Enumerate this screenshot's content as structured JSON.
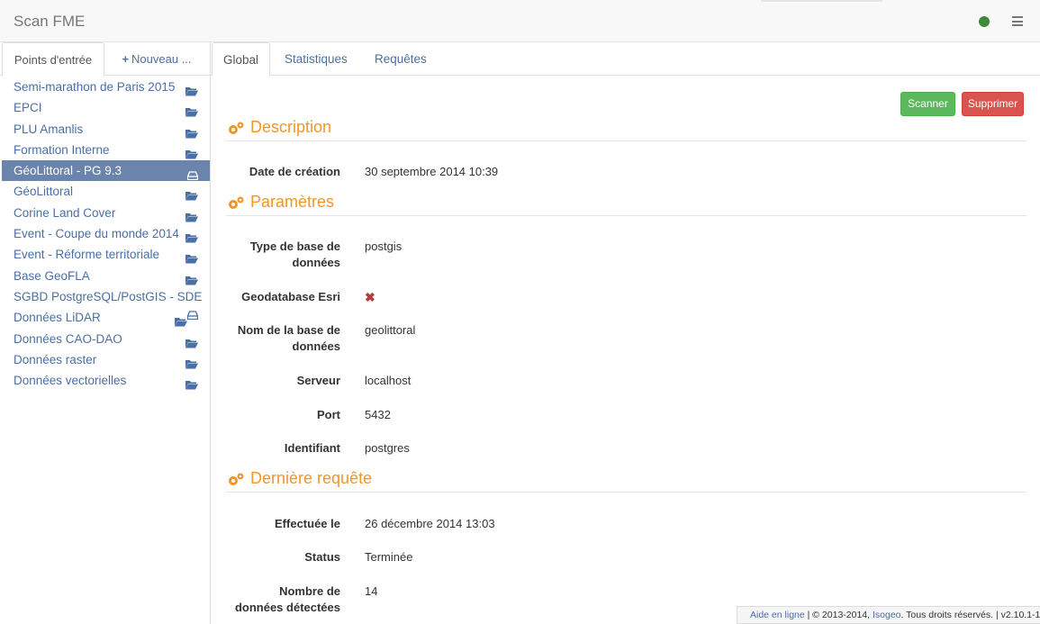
{
  "app": {
    "title": "Scan FME"
  },
  "sidebar": {
    "tabs": {
      "entry_points": "Points d'entrée",
      "new": "Nouveau ..."
    },
    "entries": [
      {
        "label": "Semi-marathon de Paris 2015",
        "icon": "folder-open-icon"
      },
      {
        "label": "EPCI",
        "icon": "folder-open-icon"
      },
      {
        "label": "PLU Amanlis",
        "icon": "folder-open-icon"
      },
      {
        "label": "Formation Interne",
        "icon": "folder-open-icon"
      },
      {
        "label": "GéoLittoral - PG 9.3",
        "icon": "database-icon"
      },
      {
        "label": "GéoLittoral",
        "icon": "folder-open-icon"
      },
      {
        "label": "Corine Land Cover",
        "icon": "folder-open-icon"
      },
      {
        "label": "Event - Coupe du monde 2014",
        "icon": "folder-open-icon"
      },
      {
        "label": "Event - Réforme territoriale",
        "icon": "folder-open-icon"
      },
      {
        "label": "Base GeoFLA",
        "icon": "folder-open-icon"
      },
      {
        "label": "SGBD PostgreSQL/PostGIS - SDE",
        "icon": ""
      },
      {
        "label": "Données LiDAR",
        "icon": "folder-database-icon"
      },
      {
        "label": "Données CAO-DAO",
        "icon": "folder-open-icon"
      },
      {
        "label": "Données raster",
        "icon": "folder-open-icon"
      },
      {
        "label": "Données vectorielles",
        "icon": "folder-open-icon"
      }
    ]
  },
  "main": {
    "tabs": [
      "Global",
      "Statistiques",
      "Requêtes"
    ],
    "buttons": {
      "scan": "Scanner",
      "delete": "Supprimer"
    },
    "description": {
      "title": "Description",
      "created_label": "Date de création",
      "created_value": "30 septembre 2014 10:39"
    },
    "params": {
      "title": "Paramètres",
      "db_type_label_1": "Type de base de",
      "db_type_label_2": "données",
      "db_type_value": "postgis",
      "esri_label": "Geodatabase Esri",
      "db_name_label_1": "Nom de la base de",
      "db_name_label_2": "données",
      "db_name_value": "geolittoral",
      "server_label": "Serveur",
      "server_value": "localhost",
      "port_label": "Port",
      "port_value": "5432",
      "user_label": "Identifiant",
      "user_value": "postgres"
    },
    "last_request": {
      "title": "Dernière requête",
      "done_label": "Effectuée le",
      "done_value": "26 décembre 2014 13:03",
      "status_label": "Status",
      "status_value": "Terminée",
      "count_label_1": "Nombre de",
      "count_label_2": "données détectées",
      "count_value": "14"
    }
  },
  "footer": {
    "help": "Aide en ligne",
    "sep1": " | © 2013-2014, ",
    "company": "Isogeo",
    "rights": ". Tous droits réservés. | v2.10.1-1"
  },
  "colors": {
    "accent": "#f0962a",
    "link": "#4a6fa5",
    "active": "#6b84ab",
    "success": "#5cb85c",
    "danger": "#d9534f",
    "status": "#3c8a3c"
  }
}
